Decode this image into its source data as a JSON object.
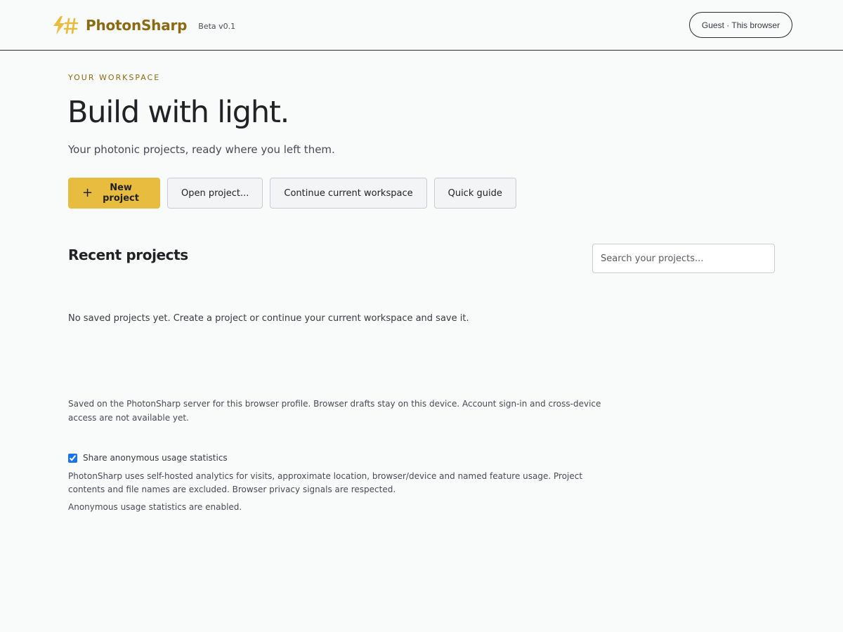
{
  "header": {
    "brand_name": "PhotonSharp",
    "brand_badge": "Beta v0.1",
    "logo_icon": "lightning-hash-icon",
    "user_label": "Guest · This browser"
  },
  "hero": {
    "eyebrow": "YOUR WORKSPACE",
    "title": "Build with light.",
    "subtitle": "Your photonic projects, ready where you left them."
  },
  "actions": {
    "new_project": "New project",
    "open_project": "Open project...",
    "continue_workspace": "Continue current workspace",
    "quick_guide": "Quick guide"
  },
  "recent": {
    "title": "Recent projects",
    "search_placeholder": "Search your projects...",
    "empty_message": "No saved projects yet. Create a project or continue your current workspace and save it."
  },
  "notes": {
    "storage": "Saved on the PhotonSharp server for this browser profile. Browser drafts stay on this device. Account sign-in and cross-device access are not available yet.",
    "consent_label": "Share anonymous usage statistics",
    "consent_checked": true,
    "analytics": "PhotonSharp uses self-hosted analytics for visits, approximate location, browser/device and named feature usage. Project contents and file names are excluded. Browser privacy signals are respected.",
    "status": "Anonymous usage statistics are enabled."
  },
  "colors": {
    "accent": "#e8bc3e",
    "brand_text": "#8a6a12",
    "background": "#f9fafa",
    "checkbox": "#1a73e8"
  }
}
